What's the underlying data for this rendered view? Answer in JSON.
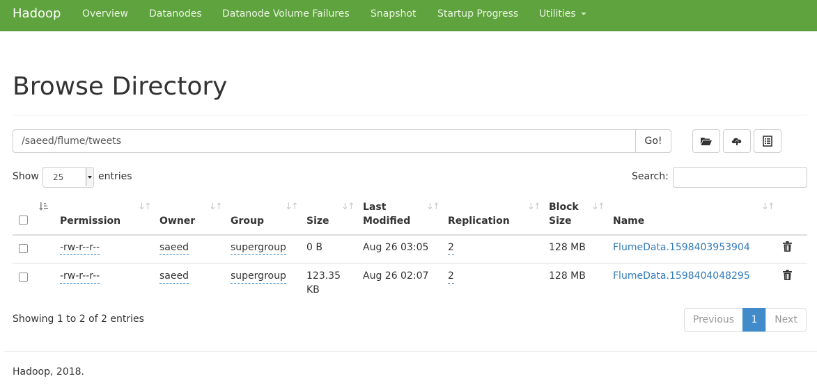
{
  "navbar": {
    "brand": "Hadoop",
    "links": [
      "Overview",
      "Datanodes",
      "Datanode Volume Failures",
      "Snapshot",
      "Startup Progress",
      "Utilities"
    ],
    "color": "#5fa33e"
  },
  "page": {
    "title": "Browse Directory",
    "path_value": "/saeed/flume/tweets",
    "go_label": "Go!",
    "toolbar_icons": [
      "folder-open-icon",
      "cloud-upload-icon",
      "list-alt-icon"
    ]
  },
  "length_control": {
    "show_label": "Show",
    "selected": "25",
    "entries_label": "entries"
  },
  "search": {
    "label": "Search:",
    "value": ""
  },
  "table": {
    "columns": [
      "Permission",
      "Owner",
      "Group",
      "Size",
      "Last Modified",
      "Replication",
      "Block Size",
      "Name"
    ],
    "column_lines": {
      "last_modified": [
        "Last",
        "Modified"
      ],
      "block_size": [
        "Block",
        "Size"
      ]
    },
    "rows": [
      {
        "permission": "-rw-r--r--",
        "owner": "saeed",
        "group": "supergroup",
        "size": "0 B",
        "last_modified": "Aug 26 03:05",
        "replication": "2",
        "block_size": "128 MB",
        "name": "FlumeData.1598403953904"
      },
      {
        "permission": "-rw-r--r--",
        "owner": "saeed",
        "group": "supergroup",
        "size_lines": [
          "123.35",
          "KB"
        ],
        "last_modified": "Aug 26 02:07",
        "replication": "2",
        "block_size": "128 MB",
        "name": "FlumeData.1598404048295"
      }
    ]
  },
  "info": "Showing 1 to 2 of 2 entries",
  "pagination": {
    "previous": "Previous",
    "current": "1",
    "next": "Next",
    "active_color": "#428bca"
  },
  "footer": "Hadoop, 2018."
}
